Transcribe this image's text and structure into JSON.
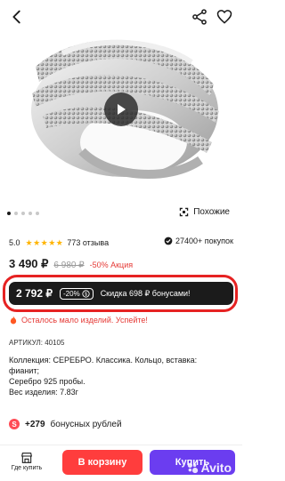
{
  "header": {
    "back_icon": "arrow-left-icon",
    "share_icon": "share-icon",
    "favorite_icon": "heart-icon"
  },
  "gallery": {
    "slides": 5,
    "active": 0,
    "similar_label": "Похожие"
  },
  "rating": {
    "value": "5.0",
    "stars": "★★★★★",
    "reviews": "773 отзыва",
    "buyers": "27400+ покупок"
  },
  "price": {
    "current": "3 490 ₽",
    "old": "6 980 ₽",
    "discount": "-50% Акция"
  },
  "promo": {
    "price": "2 792 ₽",
    "badge": "-20%",
    "text": "Скидка 698 ₽ бонусами!"
  },
  "urgency": "Осталось мало изделий. Успейте!",
  "sku": "АРТИКУЛ: 40105",
  "description": [
    "Коллекция: СЕРЕБРО. Классика. Кольцо, вставка:",
    "фианит;",
    "Серебро 925 пробы.",
    "Вес изделия: 7.83г"
  ],
  "bonus": {
    "amount": "+279",
    "text": "бонусных рублей"
  },
  "bottom": {
    "where_label": "Где купить",
    "cart_label": "В корзину",
    "buy_label": "Купить",
    "brand": "Avito"
  },
  "colors": {
    "accent_red": "#ff3d3d",
    "purple": "#6b3df0",
    "highlight": "#e62222",
    "promo_bg": "#1b1b1b"
  }
}
